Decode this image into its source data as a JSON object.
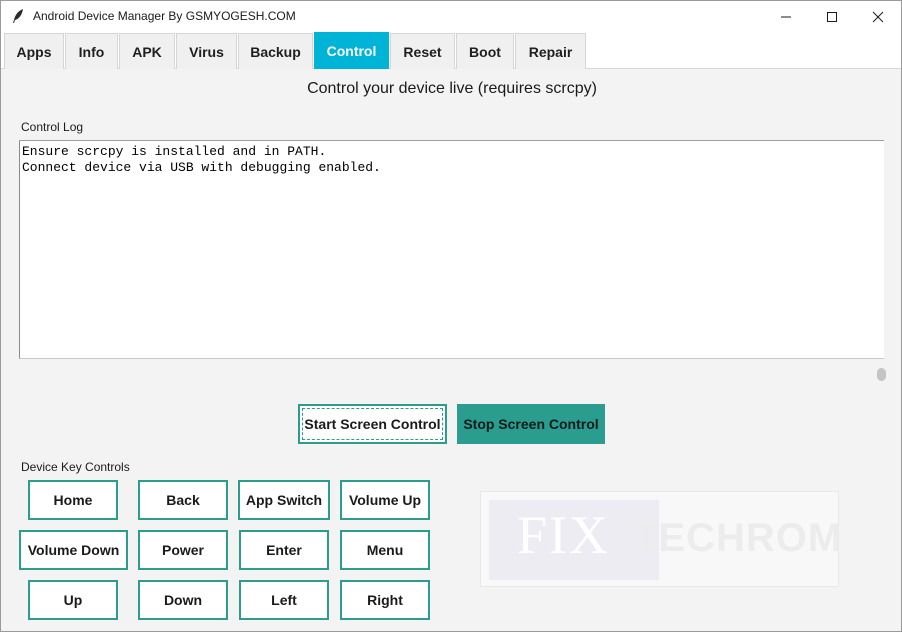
{
  "window": {
    "title": "Android Device Manager By GSMYOGESH.COM",
    "minimize_icon": "minimize-icon",
    "maximize_icon": "maximize-icon",
    "close_icon": "close-icon"
  },
  "tabs": [
    {
      "label": "Apps",
      "active": false
    },
    {
      "label": "Info",
      "active": false
    },
    {
      "label": "APK",
      "active": false
    },
    {
      "label": "Virus",
      "active": false
    },
    {
      "label": "Backup",
      "active": false
    },
    {
      "label": "Control",
      "active": true
    },
    {
      "label": "Reset",
      "active": false
    },
    {
      "label": "Boot",
      "active": false
    },
    {
      "label": "Repair",
      "active": false
    }
  ],
  "control": {
    "heading": "Control your device live (requires scrcpy)",
    "log_label": "Control Log",
    "log_lines": [
      "Ensure scrcpy is installed and in PATH.",
      "Connect device via USB with debugging enabled."
    ],
    "start_button": "Start Screen Control",
    "stop_button": "Stop Screen Control",
    "keys_label": "Device Key Controls",
    "keys": [
      "Home",
      "Back",
      "App Switch",
      "Volume Up",
      "Volume Down",
      "Power",
      "Enter",
      "Menu",
      "Up",
      "Down",
      "Left",
      "Right"
    ]
  },
  "watermark": {
    "text_left": "FIX",
    "text_right": "TECHROM"
  },
  "colors": {
    "accent_tab": "#00b4d8",
    "button_teal": "#2a9d8f"
  }
}
